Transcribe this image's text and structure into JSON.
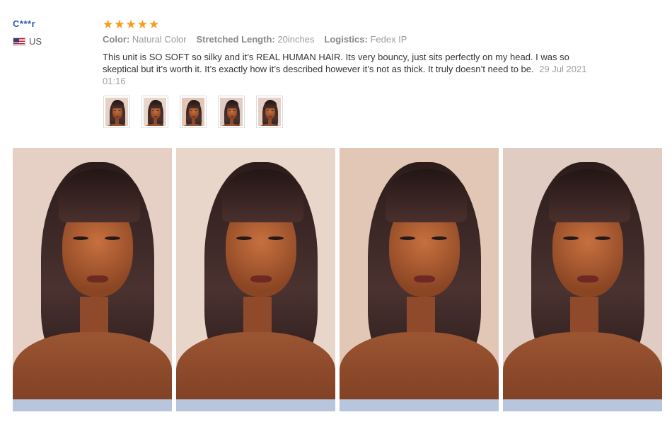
{
  "reviewer": {
    "name": "C***r",
    "country": "US",
    "flag_icon": "us-flag-icon"
  },
  "review": {
    "rating": 5,
    "star_color": "#f89c1c",
    "meta": [
      {
        "label": "Color:",
        "value": "Natural Color"
      },
      {
        "label": "Stretched Length:",
        "value": "20inches"
      },
      {
        "label": "Logistics:",
        "value": "Fedex IP"
      }
    ],
    "text": "This unit is SO SOFT so silky and it’s REAL HUMAN HAIR. Its very bouncy, just sits perfectly on my head. I was so skeptical but it’s worth it. It’s exactly how it’s described however it’s not as thick. It truly doesn’t need to be.",
    "date": "29 Jul 2021 01:16"
  },
  "thumbnails": [
    "thumb-1",
    "thumb-2",
    "thumb-3",
    "thumb-4",
    "thumb-5"
  ],
  "photos": [
    "photo-1",
    "photo-2",
    "photo-3",
    "photo-4"
  ]
}
